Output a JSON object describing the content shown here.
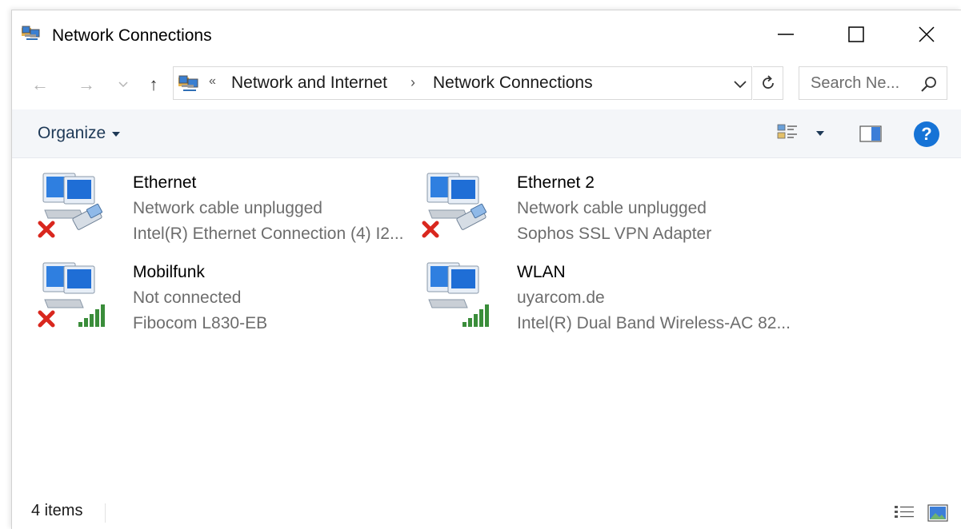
{
  "window": {
    "title": "Network Connections",
    "icon": "network-connections-icon"
  },
  "caption_buttons": {
    "minimize": "minimize-icon",
    "maximize": "maximize-icon",
    "close": "close-icon"
  },
  "navigation": {
    "back": "←",
    "forward": "→",
    "recent": "⌄",
    "up": "↑",
    "address": {
      "overflow": "«",
      "crumbs": [
        "Network and Internet",
        "Network Connections"
      ],
      "separator": "›"
    },
    "search": {
      "placeholder": "Search Ne..."
    }
  },
  "commandbar": {
    "organize_label": "Organize",
    "help_label": "?"
  },
  "connections": [
    {
      "name": "Ethernet",
      "status": "Network cable unplugged",
      "device": "Intel(R) Ethernet Connection (4) I2...",
      "type": "ethernet",
      "disconnected": true
    },
    {
      "name": "Ethernet 2",
      "status": "Network cable unplugged",
      "device": "Sophos SSL VPN Adapter",
      "type": "ethernet",
      "disconnected": true
    },
    {
      "name": "Mobilfunk",
      "status": "Not connected",
      "device": "Fibocom L830-EB",
      "type": "cellular",
      "disconnected": true
    },
    {
      "name": "WLAN",
      "status": "uyarcom.de",
      "device": "Intel(R) Dual Band Wireless-AC 82...",
      "type": "wireless",
      "disconnected": false
    }
  ],
  "statusbar": {
    "count": "4 items"
  },
  "colors": {
    "accent": "#1673d6",
    "link": "#1e3957",
    "commandbar_bg": "#f4f6f9",
    "error_red": "#d9271e",
    "signal_green": "#3a8d3a"
  }
}
